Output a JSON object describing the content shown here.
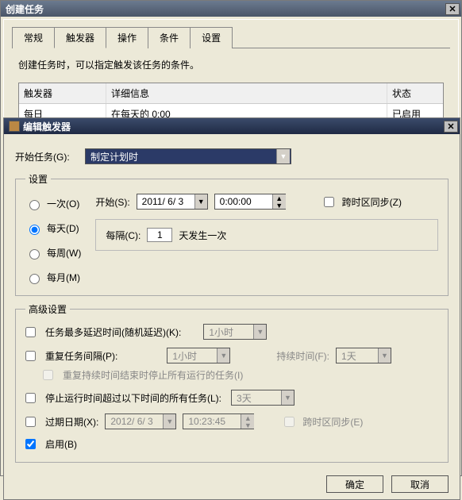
{
  "parentWindow": {
    "title": "创建任务"
  },
  "tabs": [
    "常规",
    "触发器",
    "操作",
    "条件",
    "设置"
  ],
  "activeTab": 1,
  "triggerTab": {
    "desc": "创建任务时，可以指定触发该任务的条件。",
    "cols": {
      "trigger": "触发器",
      "detail": "详细信息",
      "status": "状态"
    },
    "row": {
      "trigger": "每日",
      "detail": "在每天的 0:00",
      "status": "已启用"
    }
  },
  "editDialog": {
    "title": "编辑触发器",
    "startTask": {
      "label": "开始任务(G):",
      "value": "制定计划时"
    },
    "settings": {
      "legend": "设置",
      "radios": {
        "once": "一次(O)",
        "daily": "每天(D)",
        "weekly": "每周(W)",
        "monthly": "每月(M)"
      },
      "selected": "daily",
      "start": {
        "label": "开始(S):",
        "date": "2011/ 6/ 3",
        "time": "0:00:00"
      },
      "sync": "跨时区同步(Z)",
      "interval": {
        "prefix": "每隔(C):",
        "value": "1",
        "suffix": "天发生一次"
      }
    },
    "advanced": {
      "legend": "高级设置",
      "delay": {
        "label": "任务最多延迟时间(随机延迟)(K):",
        "value": "1小时"
      },
      "repeat": {
        "label": "重复任务间隔(P):",
        "value": "1小时",
        "durationLabel": "持续时间(F):",
        "durationValue": "1天",
        "stopLabel": "重复持续时间结束时停止所有运行的任务(I)"
      },
      "stopAfter": {
        "label": "停止运行时间超过以下时间的所有任务(L):",
        "value": "3天"
      },
      "expire": {
        "label": "过期日期(X):",
        "date": "2012/ 6/ 3",
        "time": "10:23:45",
        "sync": "跨时区同步(E)"
      },
      "enabled": "启用(B)"
    },
    "buttons": {
      "ok": "确定",
      "cancel": "取消"
    }
  }
}
